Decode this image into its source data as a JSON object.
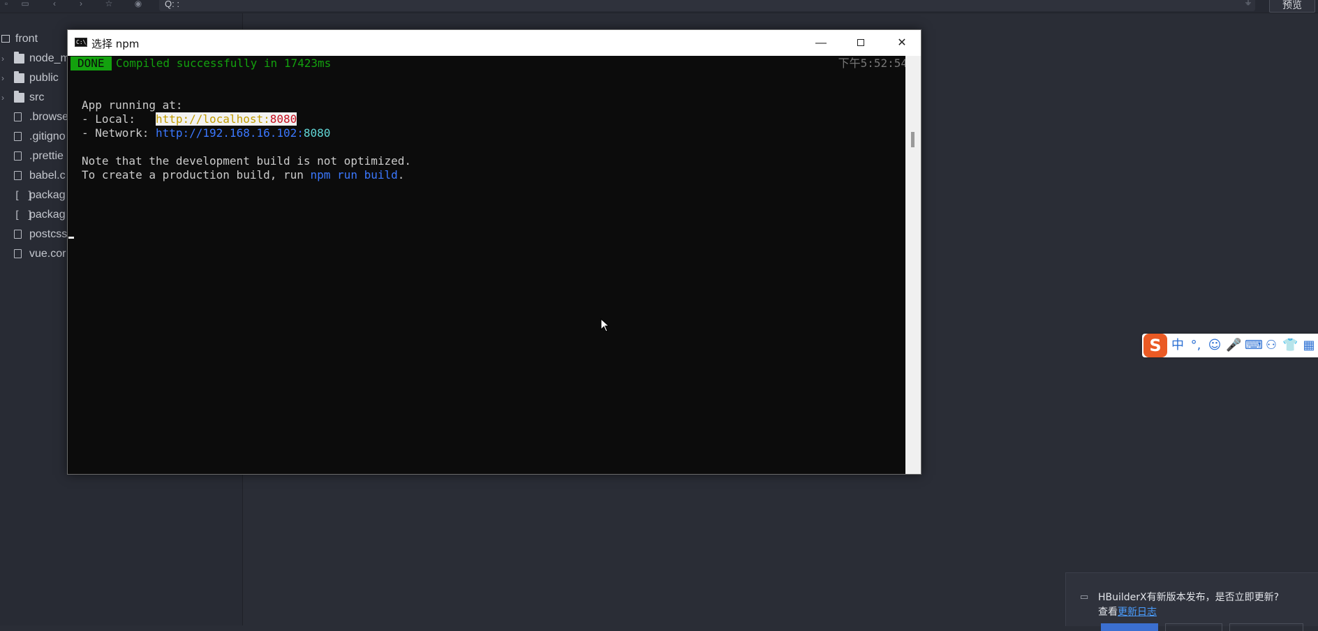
{
  "toolbar": {
    "search_glyph": "Q: :",
    "preview_label": "预览"
  },
  "sidebar": {
    "items": [
      {
        "label": "front",
        "type": "root"
      },
      {
        "label": "node_m",
        "type": "folder"
      },
      {
        "label": "public",
        "type": "folder"
      },
      {
        "label": "src",
        "type": "folder"
      },
      {
        "label": ".browse",
        "type": "file"
      },
      {
        "label": ".gitigno",
        "type": "file"
      },
      {
        "label": ".prettie",
        "type": "file"
      },
      {
        "label": "babel.c",
        "type": "file"
      },
      {
        "label": "packag",
        "type": "json"
      },
      {
        "label": "packag",
        "type": "json"
      },
      {
        "label": "postcss",
        "type": "file"
      },
      {
        "label": "vue.cor",
        "type": "file"
      }
    ],
    "json_glyph": "[ ]"
  },
  "terminal": {
    "title": "选择 npm",
    "icon_text": "C:\\_",
    "done_badge": "DONE",
    "compiled_message": "Compiled successfully in 17423ms",
    "timestamp": "下午5:52:54",
    "app_running": "App running at:",
    "local_prefix": "- Local:   ",
    "local_url_base": "http://localhost:",
    "local_url_port": "8080",
    "network_prefix": "- Network: ",
    "network_url_base": "http://192.168.16.102:",
    "network_url_port": "8080",
    "note_line": "Note that the development build is not optimized.",
    "build_prefix": "To create a production build, run ",
    "build_command": "npm run build",
    "build_suffix": "."
  },
  "window_controls": {
    "minimize": "—",
    "close": "✕"
  },
  "ime": {
    "logo": "S",
    "items": [
      "中",
      "°,",
      "☺",
      "🎤",
      "⌨",
      "⚇",
      "👕",
      "▦"
    ]
  },
  "notification": {
    "message": "HBuilderX有新版本发布，是否立即更新?",
    "view_prefix": "查看",
    "link_label": "更新日志"
  },
  "colors": {
    "terminal_bg": "#0c0c0c",
    "done_green": "#13a10e",
    "url_blue": "#3b78ff",
    "ide_bg": "#2a2d36"
  }
}
